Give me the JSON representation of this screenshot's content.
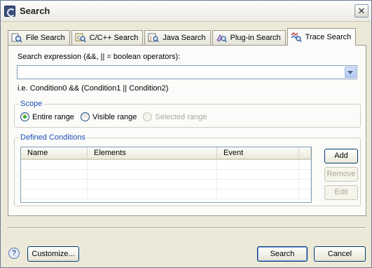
{
  "window": {
    "title": "Search",
    "close_glyph": "✕"
  },
  "tabs": [
    {
      "label": "File Search",
      "icon": "file-search-icon",
      "active": false
    },
    {
      "label": "C/C++ Search",
      "icon": "cpp-search-icon",
      "active": false
    },
    {
      "label": "Java Search",
      "icon": "java-search-icon",
      "active": false
    },
    {
      "label": "Plug-in Search",
      "icon": "plugin-search-icon",
      "active": false
    },
    {
      "label": "Trace Search",
      "icon": "trace-search-icon",
      "active": true
    }
  ],
  "search": {
    "label": "Search expression (&&, || = boolean operators):",
    "value": "",
    "hint": "i.e. Condition0 && (Condition1 || Condition2)"
  },
  "scope": {
    "title": "Scope",
    "options": [
      {
        "label": "Entire range",
        "checked": true,
        "enabled": true
      },
      {
        "label": "Visible range",
        "checked": false,
        "enabled": true
      },
      {
        "label": "Selected range",
        "checked": false,
        "enabled": false
      }
    ]
  },
  "conditions": {
    "title": "Defined Conditions",
    "columns": [
      "Name",
      "Elements",
      "Event"
    ],
    "rows": [],
    "buttons": {
      "add": "Add",
      "remove": "Remove",
      "edit": "Edit"
    }
  },
  "footer": {
    "help_glyph": "?",
    "customize": "Customize...",
    "search": "Search",
    "cancel": "Cancel"
  },
  "colors": {
    "group_title": "#1c4fb5",
    "window_bg": "#ece9d8",
    "focus_border": "#7f9db9"
  }
}
